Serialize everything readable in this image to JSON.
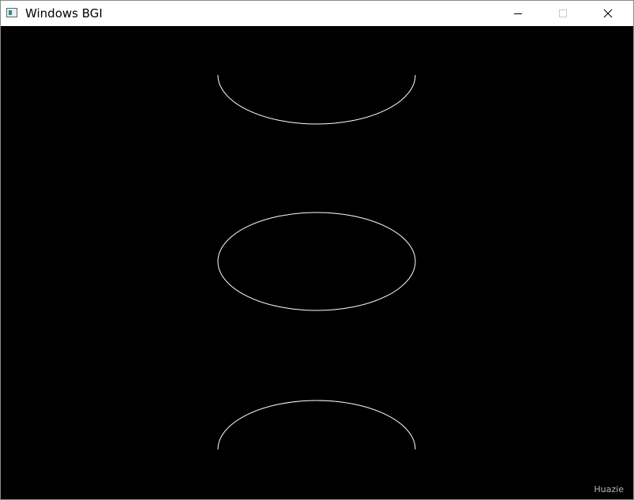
{
  "window": {
    "title": "Windows BGI",
    "controls": {
      "minimize_icon": "minimize-icon",
      "maximize_icon": "maximize-icon",
      "close_icon": "close-icon"
    }
  },
  "canvas": {
    "background": "#000000",
    "stroke_color": "#ffffff",
    "shapes": [
      {
        "kind": "lower-half-ellipse"
      },
      {
        "kind": "full-ellipse"
      },
      {
        "kind": "upper-half-ellipse"
      }
    ],
    "watermark": "Huazie"
  }
}
